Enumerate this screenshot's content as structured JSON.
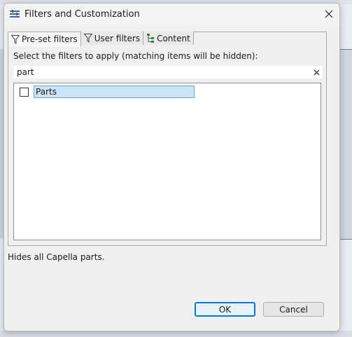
{
  "window": {
    "title": "Filters and Customization",
    "close_icon": "close-icon"
  },
  "tabs": [
    {
      "label": "Pre-set filters",
      "icon": "funnel-icon",
      "active": true
    },
    {
      "label": "User filters",
      "icon": "funnel-icon",
      "active": false
    },
    {
      "label": "Content",
      "icon": "tree-icon",
      "active": false
    }
  ],
  "instruction": "Select the filters to apply (matching items will be hidden):",
  "search": {
    "value": "part",
    "clear_icon": "clear-icon"
  },
  "filter_list": [
    {
      "label": "Parts",
      "checked": false,
      "selected": true
    }
  ],
  "description": "Hides all Capella parts.",
  "buttons": {
    "ok": "OK",
    "cancel": "Cancel"
  },
  "colors": {
    "selection_bg": "#cce4f7",
    "selection_border": "#6aa7d8",
    "default_button_border": "#0078d7"
  }
}
